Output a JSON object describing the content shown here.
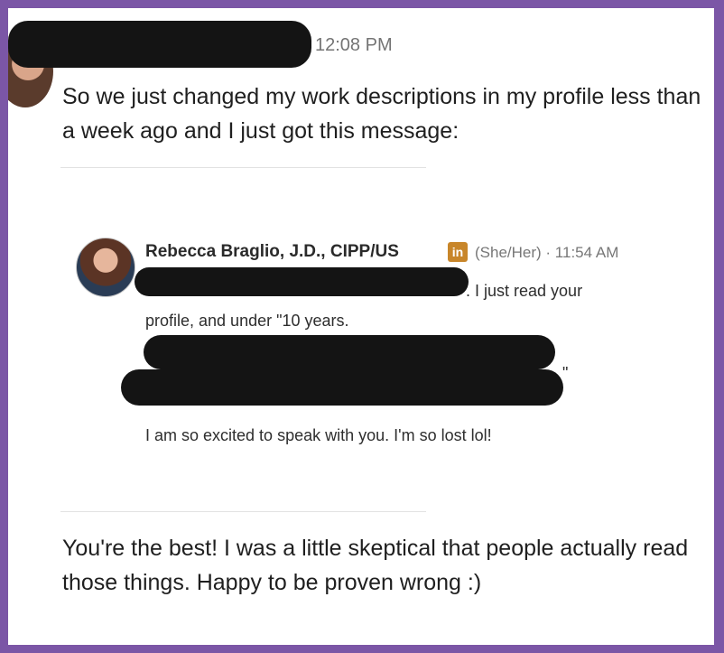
{
  "header": {
    "timestamp": "12:08 PM"
  },
  "message": {
    "text": "So we just changed my work descriptions in my profile less than a week ago and I just got this message:"
  },
  "embedded_message": {
    "sender_name": "Rebecca Braglio, J.D., CIPP/US",
    "linkedin_badge": "in",
    "pronouns_time": "(She/Her) · 11:54 AM",
    "line1_tail": ". I just read your",
    "line2": "profile, and under \"10 years.",
    "line4_tail": "\"",
    "line5": "I am so excited to speak with you. I'm so lost lol!"
  },
  "reply": {
    "text": "You're the best! I was a little skeptical that people actually read those things. Happy to be proven wrong :)"
  },
  "colors": {
    "border": "#7b56a6",
    "redaction": "#141414",
    "linkedin_badge": "#c8862a"
  }
}
